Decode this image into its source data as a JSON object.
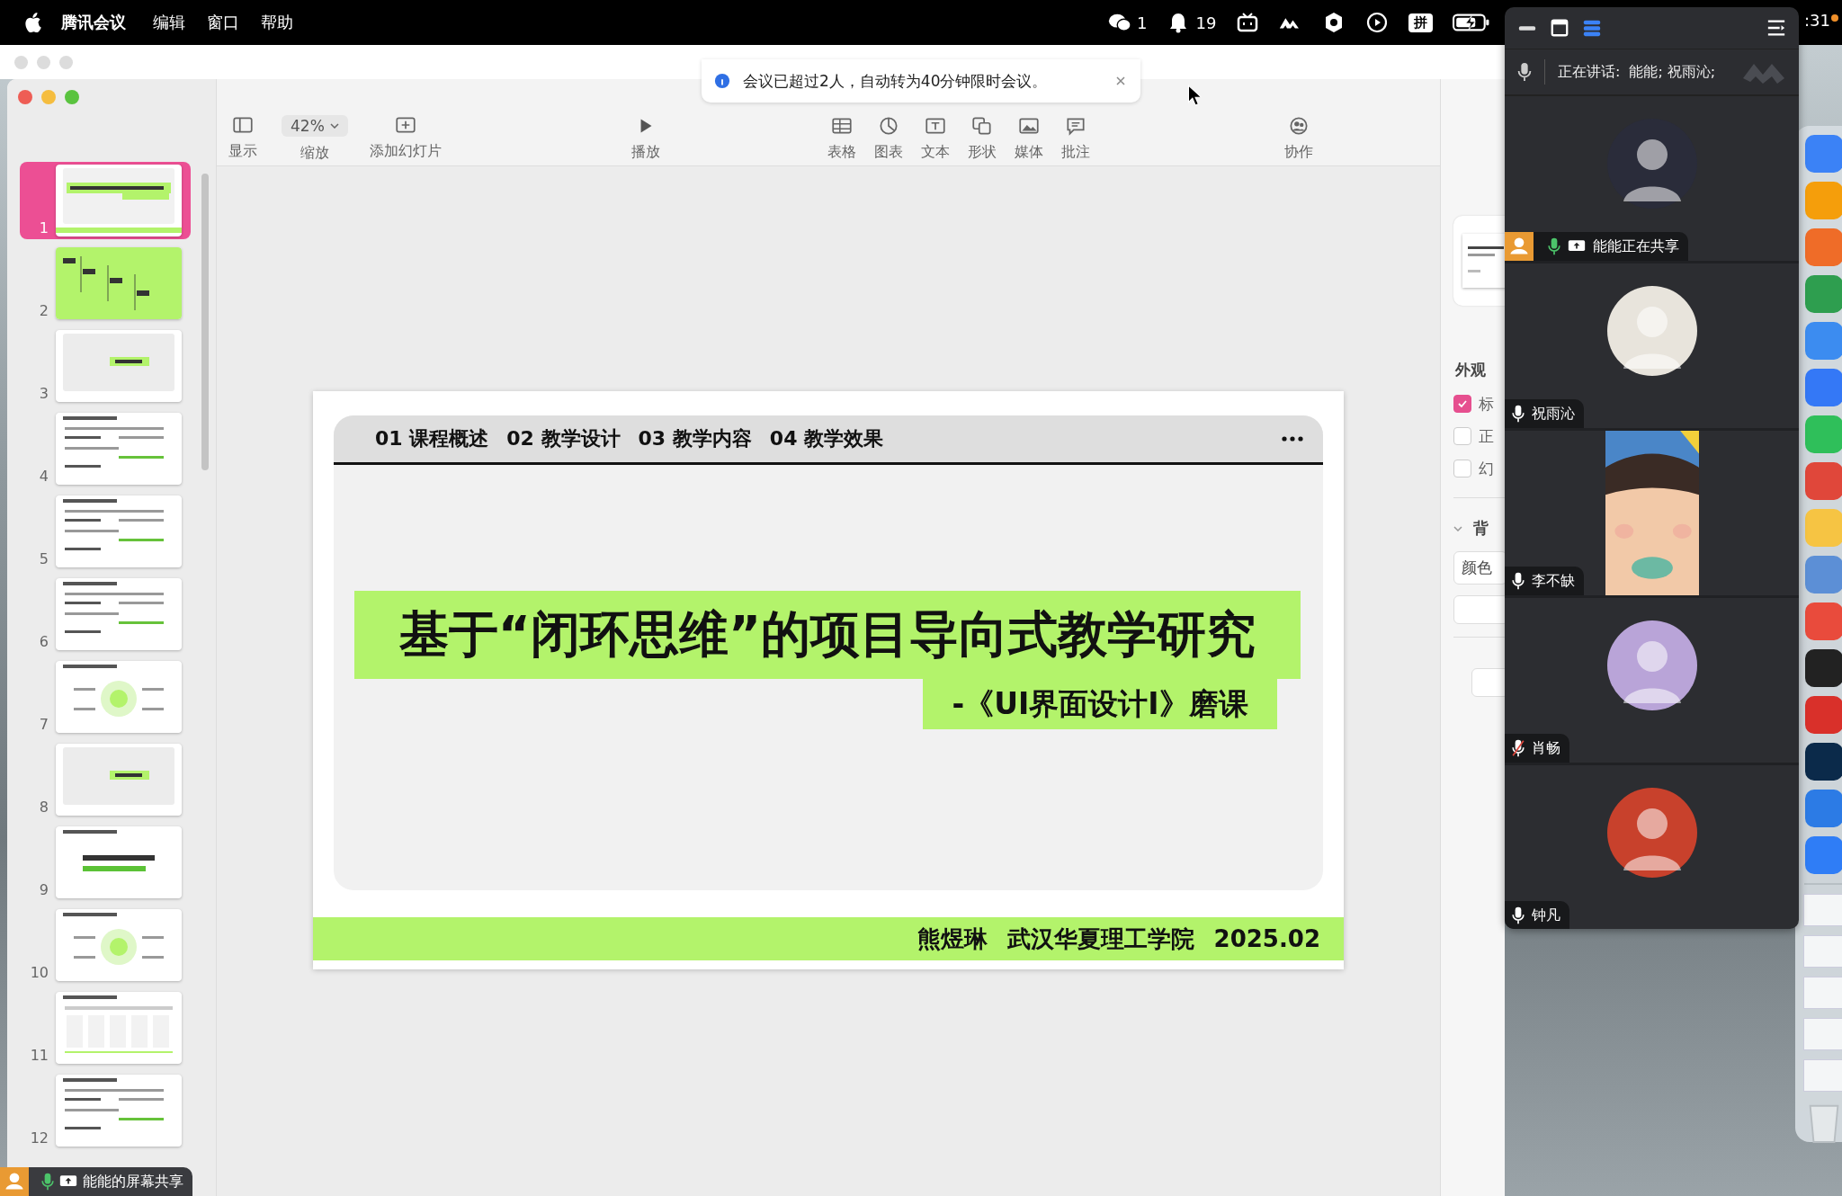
{
  "menu_bar": {
    "app_name": "腾讯会议",
    "menus": [
      "编辑",
      "窗口",
      "帮助"
    ],
    "status": [
      {
        "kind": "chat",
        "text": "1"
      },
      {
        "kind": "bell",
        "text": "19"
      },
      {
        "kind": "tv"
      },
      {
        "kind": "wave"
      },
      {
        "kind": "hex"
      },
      {
        "kind": "play"
      }
    ],
    "input_method": "拼",
    "clock": ":31"
  },
  "notification": {
    "text": "会议已超过2人，自动转为40分钟限时会议。"
  },
  "toolbar": {
    "items": [
      {
        "kind": "view",
        "label": "显示"
      },
      {
        "kind": "zoom",
        "label": "缩放",
        "value": "42%"
      },
      {
        "kind": "add",
        "label": "添加幻灯片"
      },
      {
        "kind": "play",
        "label": "播放"
      },
      {
        "kind": "table",
        "label": "表格"
      },
      {
        "kind": "chart",
        "label": "图表"
      },
      {
        "kind": "text",
        "label": "文本"
      },
      {
        "kind": "shape",
        "label": "形状"
      },
      {
        "kind": "media",
        "label": "媒体"
      },
      {
        "kind": "comment",
        "label": "批注"
      },
      {
        "kind": "collab",
        "label": "协作"
      }
    ]
  },
  "slides": [
    {
      "number": "1",
      "kind": "title",
      "selected": true
    },
    {
      "number": "2",
      "kind": "agenda",
      "selected": false
    },
    {
      "number": "3",
      "kind": "section",
      "selected": false
    },
    {
      "number": "4",
      "kind": "text",
      "selected": false
    },
    {
      "number": "5",
      "kind": "text",
      "selected": false
    },
    {
      "number": "6",
      "kind": "text",
      "selected": false
    },
    {
      "number": "7",
      "kind": "diagram",
      "selected": false
    },
    {
      "number": "8",
      "kind": "section",
      "selected": false
    },
    {
      "number": "9",
      "kind": "statement",
      "selected": false
    },
    {
      "number": "10",
      "kind": "diagram",
      "selected": false
    },
    {
      "number": "11",
      "kind": "table",
      "selected": false
    },
    {
      "number": "12",
      "kind": "text",
      "selected": false
    }
  ],
  "slide": {
    "nav": [
      "01 课程概述",
      "02 教学设计",
      "03 教学内容",
      "04 教学效果"
    ],
    "title": "基于“闭环思维”的项目导向式教学研究",
    "subtitle": "-《UI界面设计I》磨课",
    "footer": [
      "熊煜琳",
      "武汉华夏理工学院",
      "2025.02"
    ]
  },
  "inspector": {
    "heading": "外观",
    "options": [
      {
        "label": "标",
        "checked": true
      },
      {
        "label": "正",
        "checked": false
      },
      {
        "label": "幻",
        "checked": false
      }
    ],
    "section": "背",
    "color_button": "颜色"
  },
  "meeting": {
    "speaking_label": "正在讲话:",
    "speakers": "能能; 祝雨沁;",
    "participants": [
      {
        "name": "能能正在共享",
        "kind": "sharer",
        "muted": false,
        "color": "#2a2c3a"
      },
      {
        "name": "祝雨沁",
        "kind": "avatar",
        "muted": false,
        "color": "#e8e4dc"
      },
      {
        "name": "李不缺",
        "muted": false,
        "color": "#f2c9a8"
      },
      {
        "name": "肖畅",
        "kind": "avatar",
        "muted": true,
        "color": "#b9a4d8"
      },
      {
        "name": "钟凡",
        "kind": "avatar",
        "muted": false,
        "color": "#c8412c"
      }
    ]
  },
  "share_bar": {
    "text": "能能的屏幕共享"
  }
}
